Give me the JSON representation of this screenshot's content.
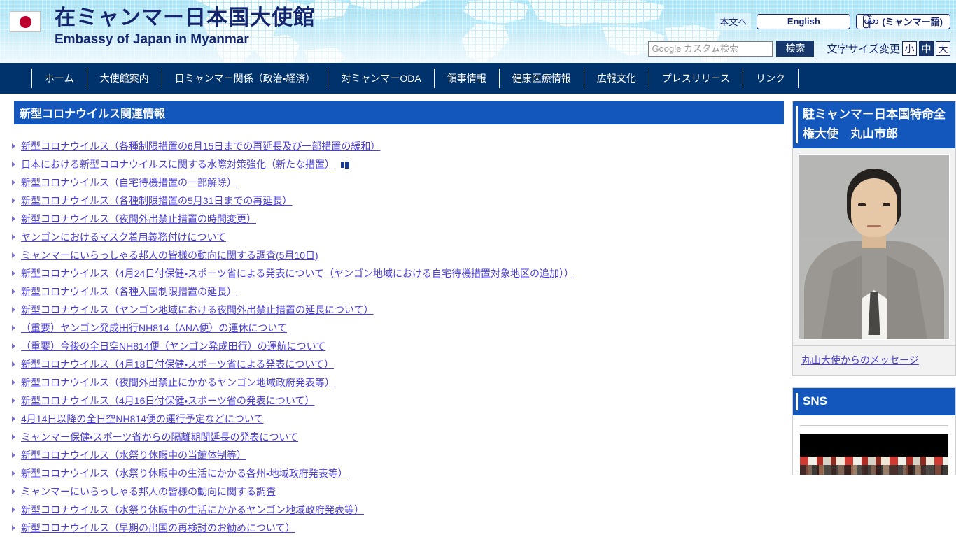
{
  "header": {
    "flag_icon": "japan-flag-icon",
    "title_ja": "在ミャンマー日本国大使館",
    "title_en": "Embassy of Japan in Myanmar",
    "skip_link": "本文へ",
    "lang_english": "English",
    "lang_myanmar_burmese": "မြန်မာ",
    "lang_myanmar_ja": "(ミャンマー語)",
    "search_placeholder": "Google カスタム検索",
    "search_value": "",
    "search_button": "検索",
    "fontsize_label": "文字サイズ変更",
    "fontsize_options": [
      "小",
      "中",
      "大"
    ],
    "fontsize_selected": "中"
  },
  "nav": {
    "items": [
      {
        "label": "ホーム"
      },
      {
        "label": "大使館案内"
      },
      {
        "label": "日ミャンマー関係（政治・経済）"
      },
      {
        "label": "対ミャンマーODA"
      },
      {
        "label": "領事情報"
      },
      {
        "label": "健康医療情報"
      },
      {
        "label": "広報文化"
      },
      {
        "label": "プレスリリース"
      },
      {
        "label": "リンク"
      }
    ]
  },
  "main": {
    "section_title": "新型コロナウイルス関連情報",
    "links": [
      {
        "label": "新型コロナウイルス（各種制限措置の6月15日までの再延長及び一部措置の緩和）",
        "external": false
      },
      {
        "label": "日本における新型コロナウイルスに関する水際対策強化（新たな措置）",
        "external": true
      },
      {
        "label": "新型コロナウイルス（自宅待機措置の一部解除）",
        "external": false
      },
      {
        "label": "新型コロナウイルス（各種制限措置の5月31日までの再延長）",
        "external": false
      },
      {
        "label": "新型コロナウイルス（夜間外出禁止措置の時間変更）",
        "external": false
      },
      {
        "label": "ヤンゴンにおけるマスク着用義務付けについて",
        "external": false
      },
      {
        "label": "ミャンマーにいらっしゃる邦人の皆様の動向に関する調査(5月10日)",
        "external": false
      },
      {
        "label": "新型コロナウイルス（4月24日付保健・スポーツ省による発表について（ヤンゴン地域における自宅待機措置対象地区の追加））",
        "external": false
      },
      {
        "label": "新型コロナウイルス（各種入国制限措置の延長）",
        "external": false
      },
      {
        "label": "新型コロナウイルス（ヤンゴン地域における夜間外出禁止措置の延長について）",
        "external": false
      },
      {
        "label": "（重要）ヤンゴン発成田行NH814（ANA便）の運休について",
        "external": false
      },
      {
        "label": "（重要）今後の全日空NH814便（ヤンゴン発成田行）の運航について",
        "external": false
      },
      {
        "label": "新型コロナウイルス（4月18日付保健・スポーツ省による発表について）",
        "external": false
      },
      {
        "label": "新型コロナウイルス（夜間外出禁止にかかるヤンゴン地域政府発表等）",
        "external": false
      },
      {
        "label": "新型コロナウイルス（4月16日付保健・スポーツ省の発表について）",
        "external": false
      },
      {
        "label": "4月14日以降の全日空NH814便の運行予定などについて",
        "external": false
      },
      {
        "label": "ミャンマー保健・スポーツ省からの隔離期間延長の発表について",
        "external": false
      },
      {
        "label": "新型コロナウイルス（水祭り休暇中の当館体制等）",
        "external": false
      },
      {
        "label": "新型コロナウイルス（水祭り休暇中の生活にかかる各州・地域政府発表等）",
        "external": false
      },
      {
        "label": "ミャンマーにいらっしゃる邦人の皆様の動向に関する調査",
        "external": false
      },
      {
        "label": "新型コロナウイルス（水祭り休暇中の生活にかかるヤンゴン地域政府発表等）",
        "external": false
      },
      {
        "label": "新型コロナウイルス（早期の出国の再検討のお勧めについて）",
        "external": false
      }
    ]
  },
  "sidebar": {
    "ambassador": {
      "title": "駐ミャンマー日本国特命全権大使　丸山市郎",
      "photo_alt": "ambassador-portrait",
      "message_link": "丸山大使からのメッセージ"
    },
    "sns": {
      "title": "SNS"
    }
  }
}
